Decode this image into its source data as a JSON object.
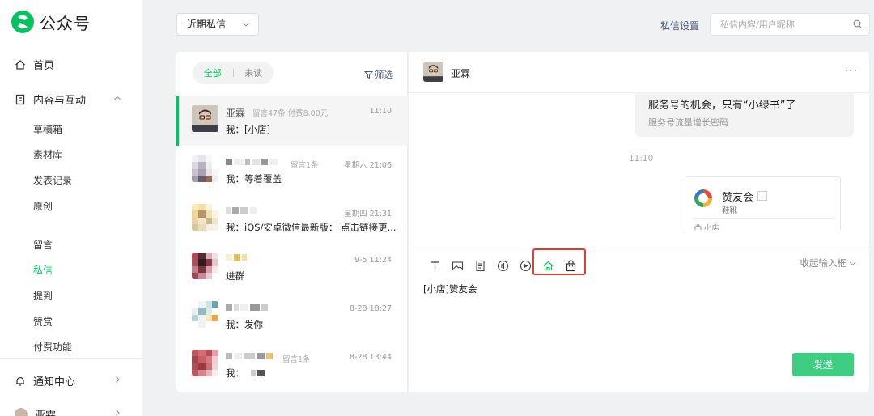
{
  "app": {
    "title": "公众号"
  },
  "sidebar": {
    "home": "首页",
    "content": "内容与互动",
    "content_items": [
      "草稿箱",
      "素材库",
      "发表记录",
      "原创"
    ],
    "interact_items": [
      "留言",
      "私信",
      "提到",
      "赞赏",
      "付费功能"
    ],
    "notify": "通知中心",
    "user": "亚霖"
  },
  "topbar": {
    "filter": "近期私信",
    "settings": "私信设置",
    "search_placeholder": "私信内容/用户昵称"
  },
  "list": {
    "tabs": [
      "全部",
      "未读"
    ],
    "filter_label": "筛选",
    "conversations": [
      {
        "name": "亚霖",
        "meta": "留言47条   付费8.00元",
        "time": "11:10",
        "msg": "我：[小店]"
      },
      {
        "name": "",
        "meta": "留言1条",
        "time": "星期六 21:06",
        "msg": "我：等着覆盖"
      },
      {
        "name": "",
        "meta": "",
        "time": "星期四 21:31",
        "msg": "我：iOS/安卓微信最新版：  点击链接更..."
      },
      {
        "name": "",
        "meta": "",
        "time": "9-5 11:24",
        "msg": "进群"
      },
      {
        "name": "",
        "meta": "",
        "time": "8-28 18:27",
        "msg": "我：发你"
      },
      {
        "name": "",
        "meta": "留言1条",
        "time": "8-28 13:44",
        "msg": "我："
      }
    ]
  },
  "chat": {
    "name": "亚霖",
    "more": "···",
    "prev_card_title": "服务号的机会，只有“小绿书”了",
    "prev_card_sub": "服务号流量增长密码",
    "time": "11:10",
    "shop_title": "赞友会",
    "shop_sub": "鞋靴",
    "shop_foot": "小店",
    "collapse": "收起输入框",
    "input_value": "[小店]赞友会",
    "send": "发送"
  },
  "colors": {
    "accent": "#07c160",
    "highlight": "#e43d30",
    "link": "#4b5a7a"
  }
}
